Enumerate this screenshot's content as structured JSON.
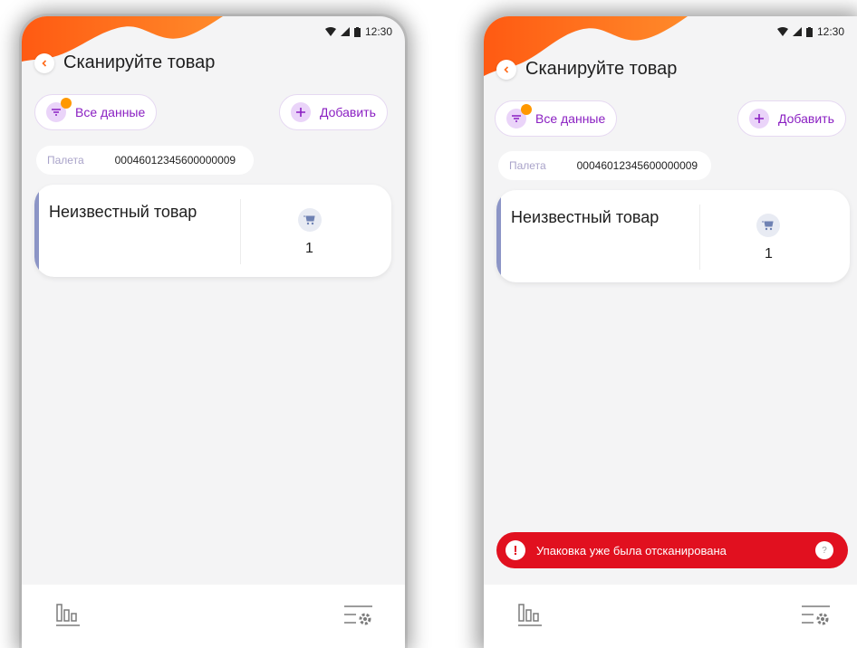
{
  "status_bar": {
    "time": "12:30"
  },
  "screens": [
    {
      "header": {
        "title": "Сканируйте товар"
      },
      "filter_chip": {
        "label": "Все данные"
      },
      "add_button": {
        "label": "Добавить"
      },
      "pallet": {
        "label": "Палета",
        "value": "00046012345600000009"
      },
      "item": {
        "name": "Неизвестный товар",
        "quantity": "1"
      }
    },
    {
      "header": {
        "title": "Сканируйте товар"
      },
      "filter_chip": {
        "label": "Все данные"
      },
      "add_button": {
        "label": "Добавить"
      },
      "pallet": {
        "label": "Палета",
        "value": "00046012345600000009"
      },
      "item": {
        "name": "Неизвестный товар",
        "quantity": "1"
      },
      "toast": {
        "message": "Упаковка уже была отсканирована",
        "help": "?"
      }
    }
  ],
  "icons": [
    "back-arrow-icon",
    "filter-icon",
    "plus-icon",
    "cart-icon",
    "warning-icon",
    "help-icon",
    "statistics-icon",
    "settings-list-icon",
    "wifi-icon",
    "signal-icon",
    "battery-icon"
  ],
  "colors": {
    "accent": "#8a1fc2",
    "wave": "#ff6a1a",
    "badge": "#ff9800",
    "error": "#e1101f",
    "item_bar": "#8c95c6"
  }
}
